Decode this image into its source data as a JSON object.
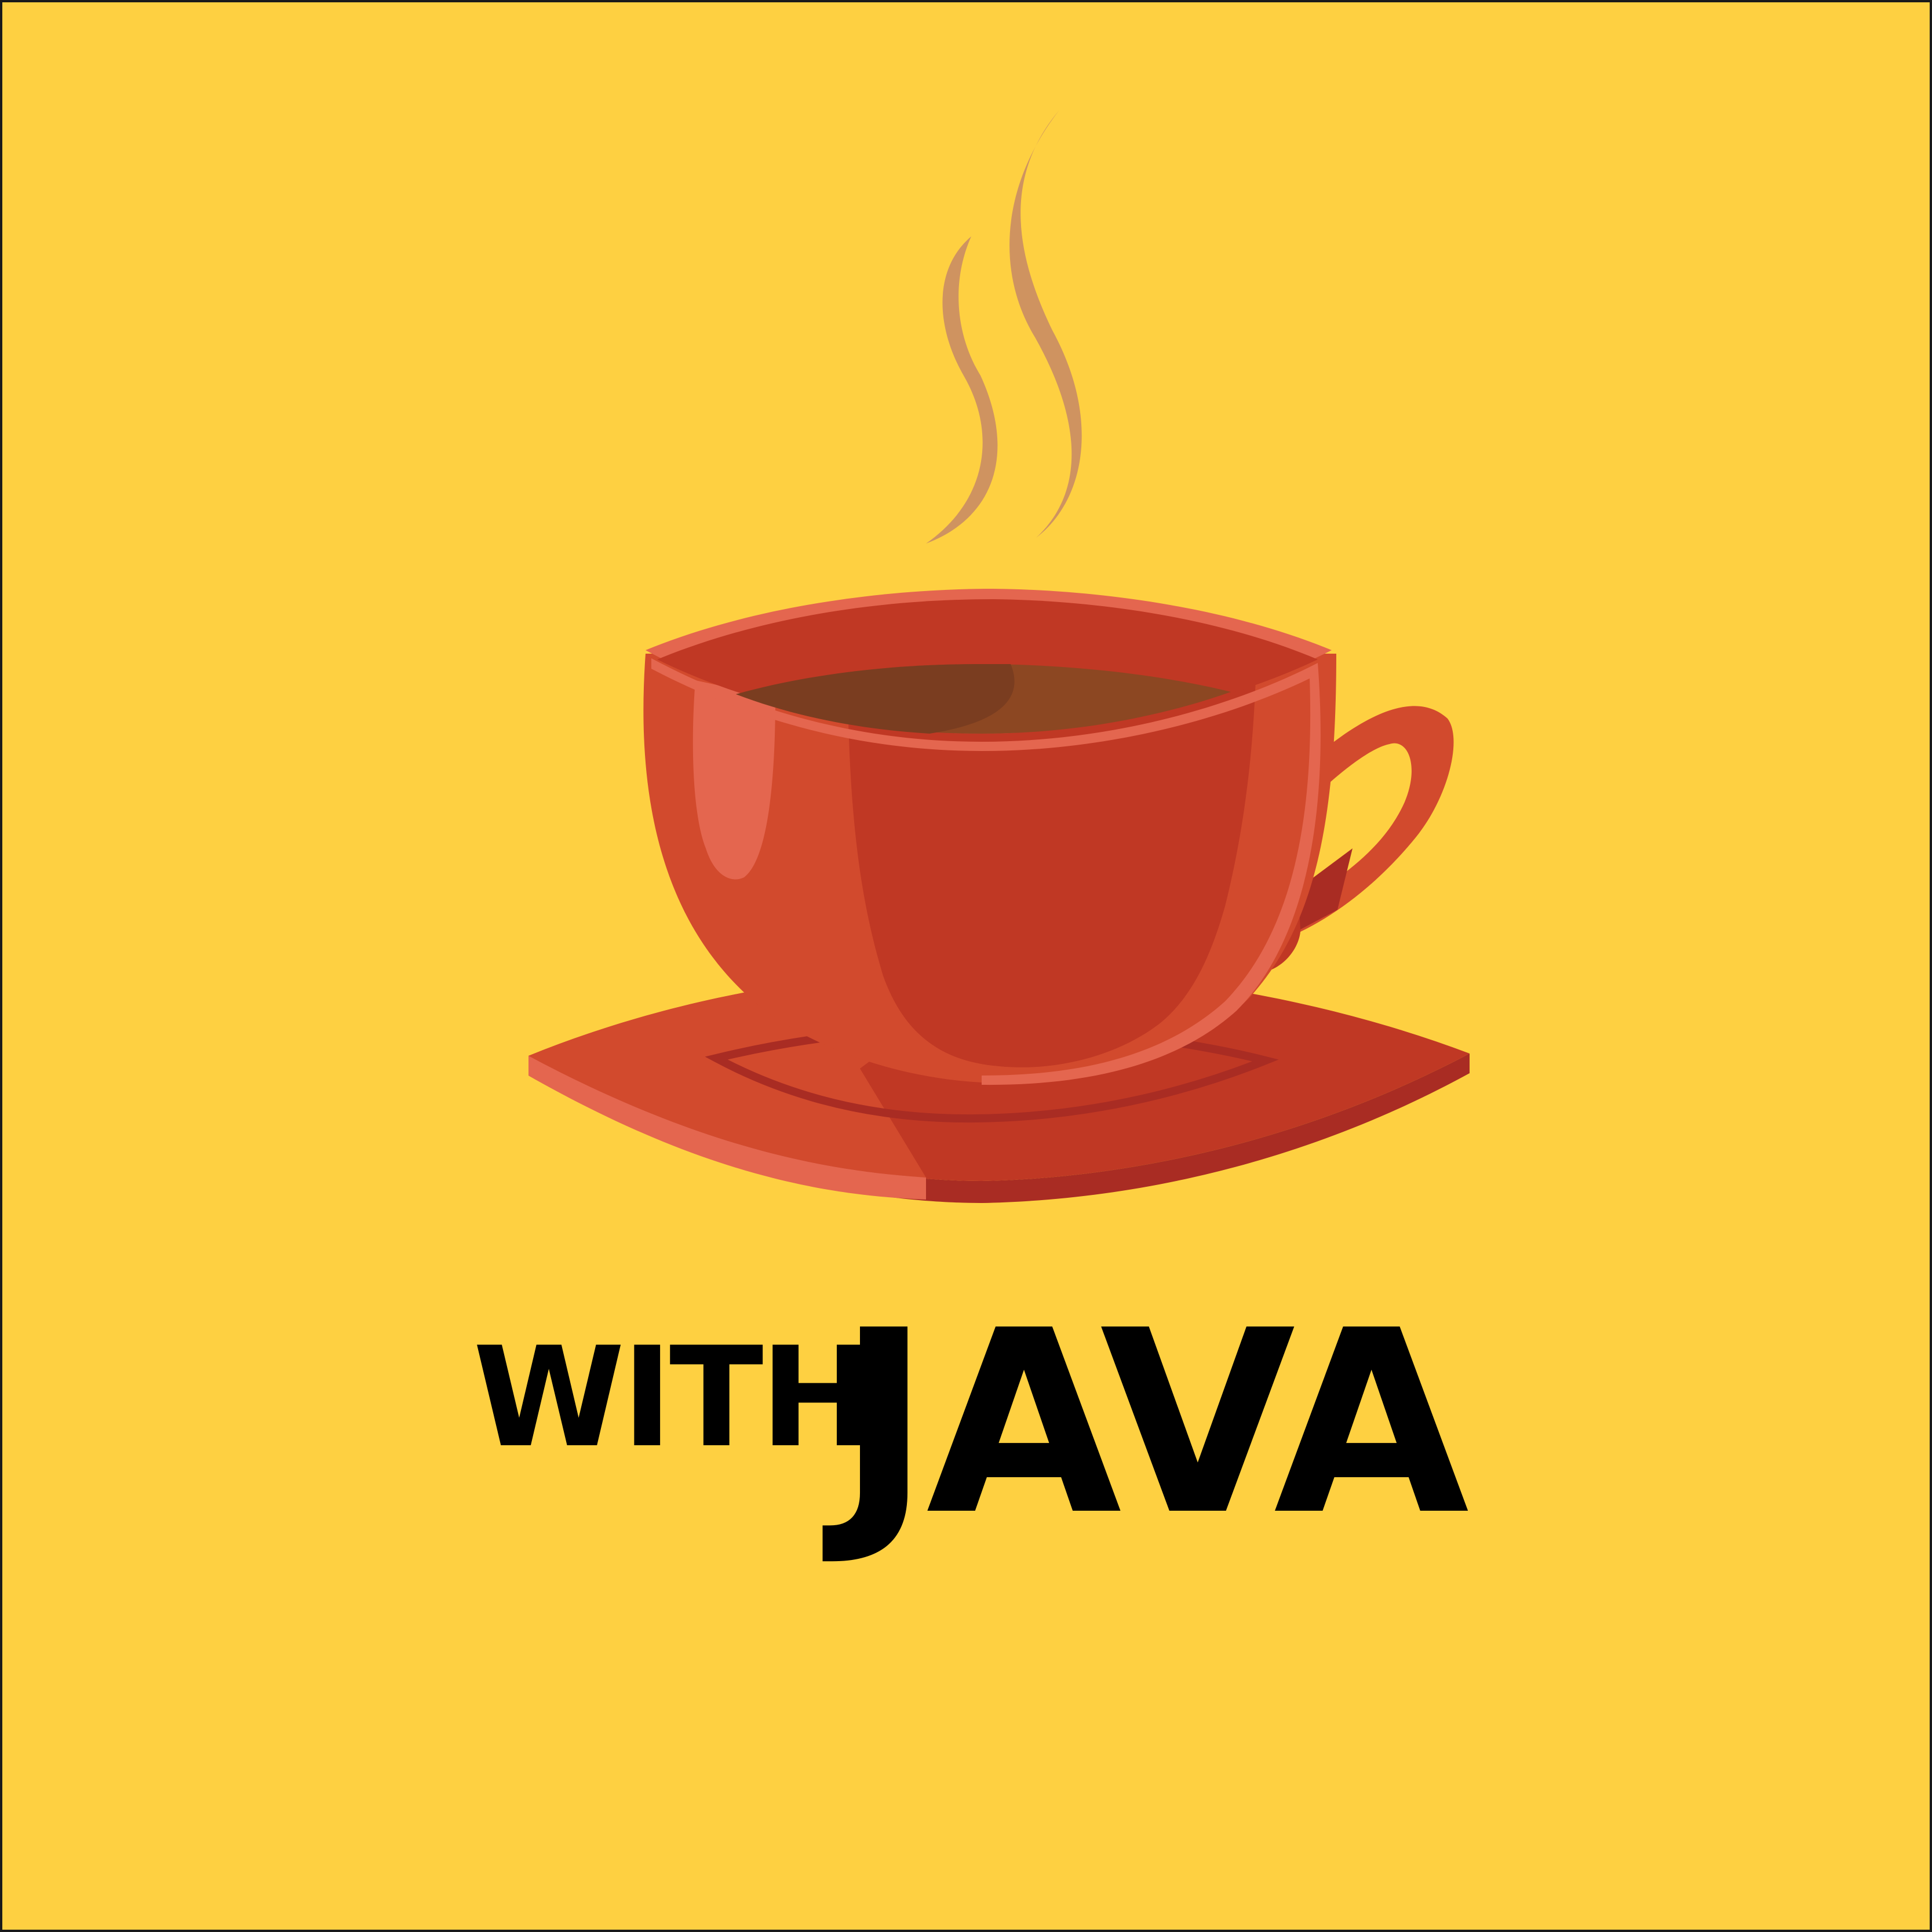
{
  "title": {
    "small_word": "WITH",
    "big_word": "JAVA"
  },
  "illustration": {
    "icon": "coffee-cup-icon",
    "steam_icon": "steam-icon"
  },
  "colors": {
    "background": "#FED041",
    "cup_main": "#D24A2D",
    "cup_shadow": "#C03824",
    "cup_highlight": "#E4664F",
    "cup_dark": "#A92C23",
    "coffee_light": "#8C4722",
    "coffee_dark": "#7A3D20",
    "steam": "#CF9360",
    "text": "#000000"
  }
}
